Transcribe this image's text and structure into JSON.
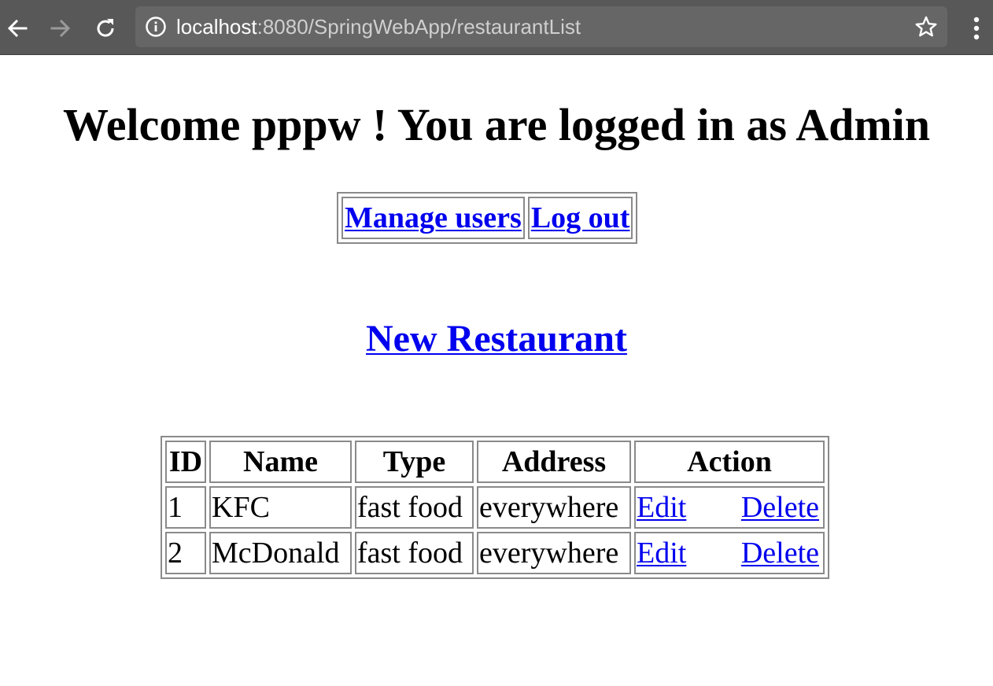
{
  "browser": {
    "url_host": "localhost",
    "url_rest": ":8080/SpringWebApp/restaurantList",
    "icons": {
      "back": "arrow-left-icon",
      "forward": "arrow-right-icon",
      "reload": "reload-icon",
      "info": "info-circle-icon",
      "bookmark": "star-icon",
      "menu": "kebab-menu-icon"
    },
    "colors": {
      "toolbar": "#585858",
      "omnibox": "#666666"
    }
  },
  "page": {
    "welcome": "Welcome pppw ! You are logged in as Admin",
    "nav": {
      "manage_users": "Manage users",
      "log_out": "Log out"
    },
    "new_restaurant": "New Restaurant",
    "link_color": "#0000ee"
  },
  "table": {
    "headers": [
      "ID",
      "Name",
      "Type",
      "Address",
      "Action"
    ],
    "rows": [
      {
        "id": "1",
        "name": "KFC",
        "type": "fast food",
        "address": "everywhere",
        "edit": "Edit",
        "delete": "Delete"
      },
      {
        "id": "2",
        "name": "McDonald",
        "type": "fast food",
        "address": "everywhere",
        "edit": "Edit",
        "delete": "Delete"
      }
    ]
  }
}
